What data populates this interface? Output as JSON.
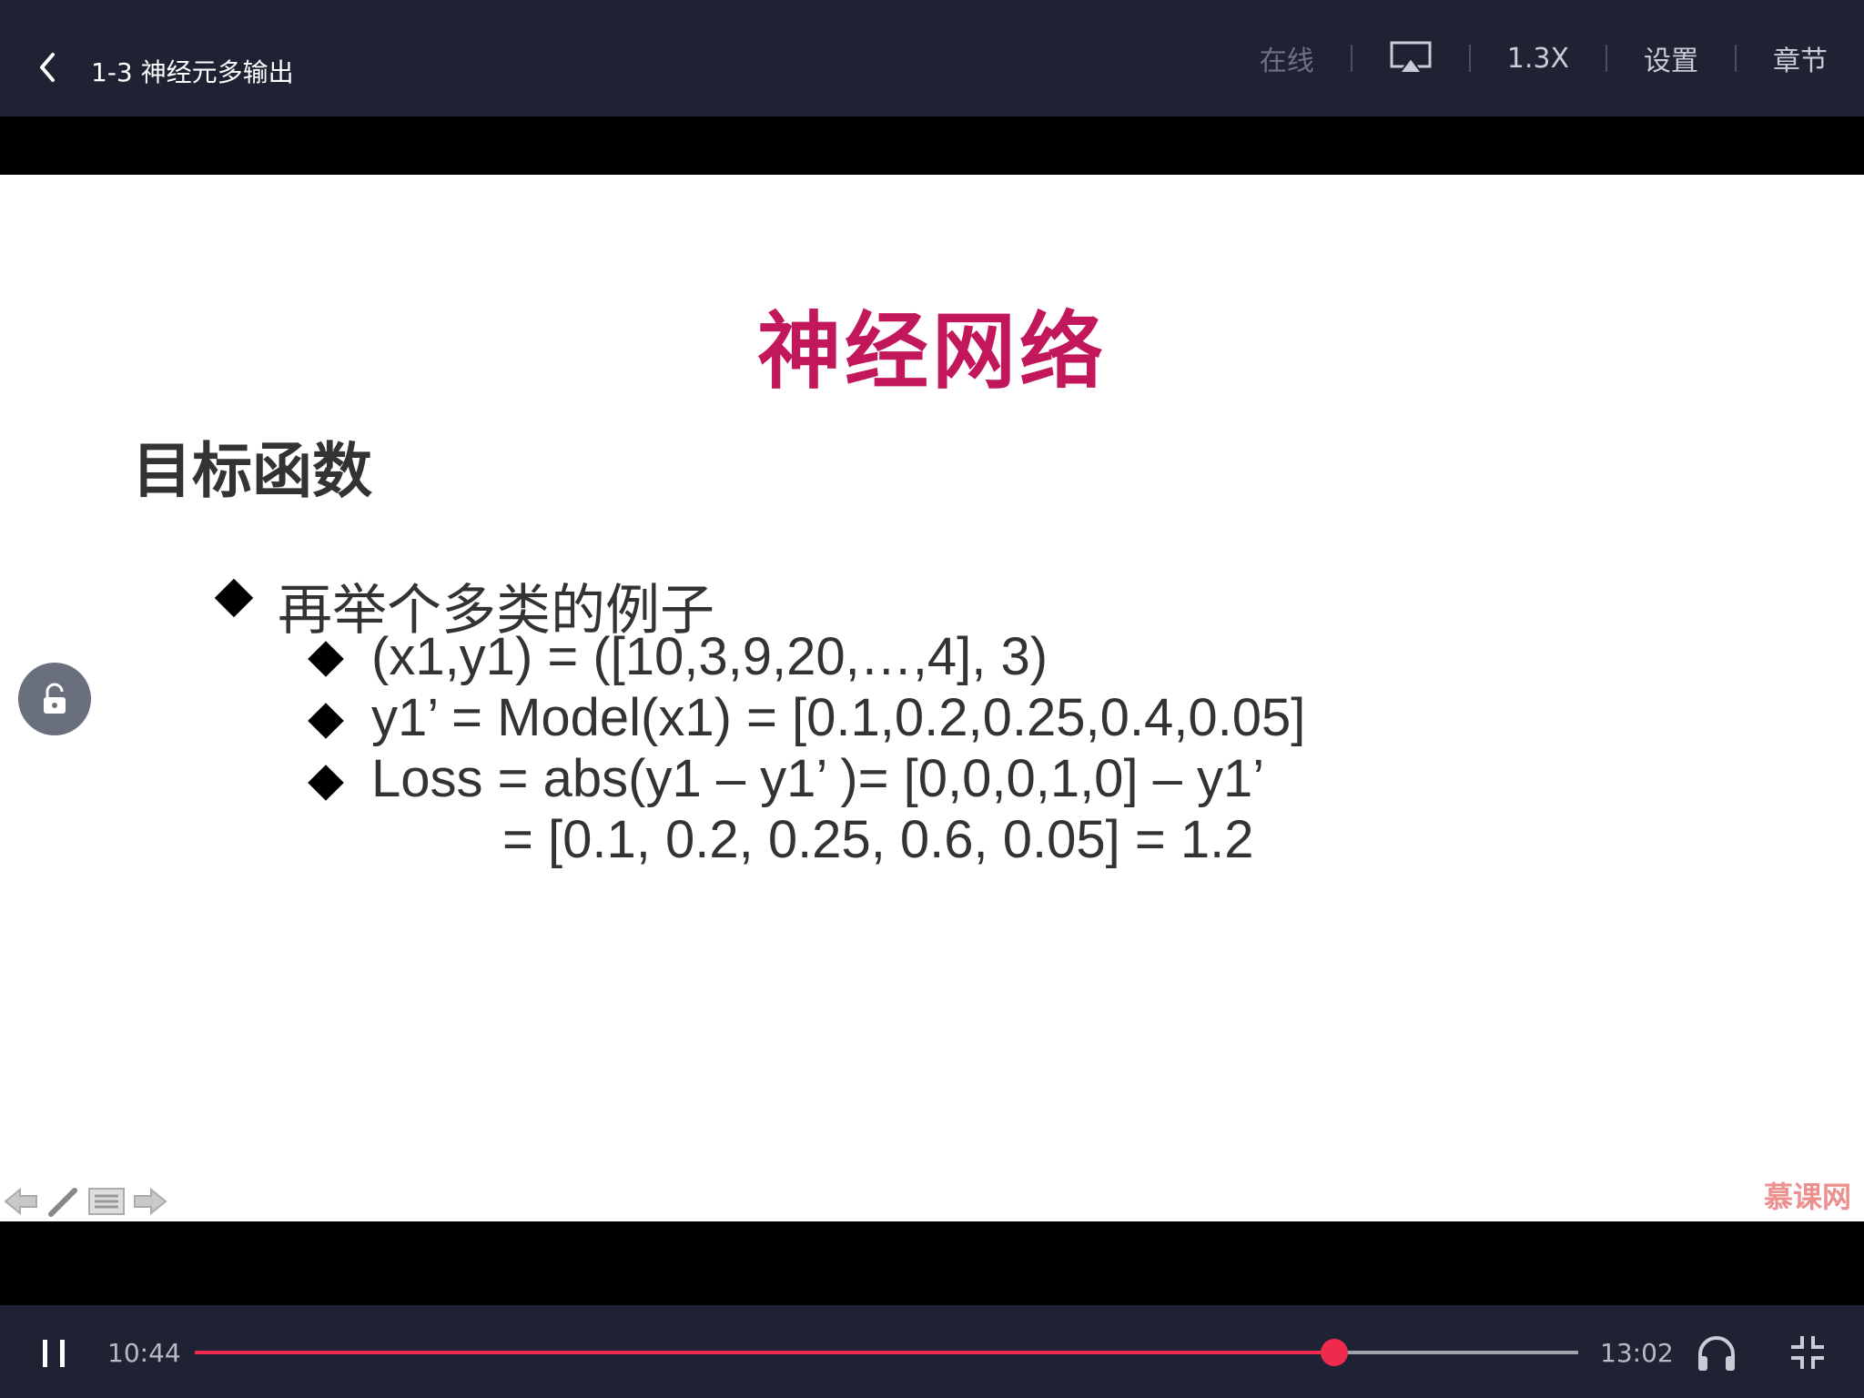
{
  "header": {
    "title": "1-3 神经元多输出",
    "online_label": "在线",
    "speed_label": "1.3X",
    "settings_label": "设置",
    "chapters_label": "章节",
    "icons": [
      "back-chevron-icon",
      "airplay-icon"
    ]
  },
  "slide": {
    "title": "神经网络",
    "heading": "目标函数",
    "bullets": [
      {
        "level": 1,
        "text": "再举个多类的例子"
      },
      {
        "level": 2,
        "text": "(x1,y1) = ([10,3,9,20,…,4], 3)"
      },
      {
        "level": 2,
        "text": "y1’  = Model(x1) = [0.1,0.2,0.25,0.4,0.05]"
      },
      {
        "level": 2,
        "text": "Loss = abs(y1 – y1’ )= [0,0,0,1,0] – y1’"
      },
      {
        "level": 0,
        "text": "= [0.1, 0.2, 0.25, 0.6, 0.05] = 1.2"
      }
    ],
    "watermark": "慕课网",
    "tool_icons": [
      "arrow-left-icon",
      "pen-icon",
      "menu-icon",
      "arrow-right-icon"
    ]
  },
  "controls": {
    "current_time": "10:44",
    "total_time": "13:02",
    "progress": 0.824,
    "accent_color": "#f0294f",
    "icons": [
      "pause-icon",
      "headphones-icon",
      "exit-fullscreen-icon",
      "lock-icon"
    ]
  }
}
